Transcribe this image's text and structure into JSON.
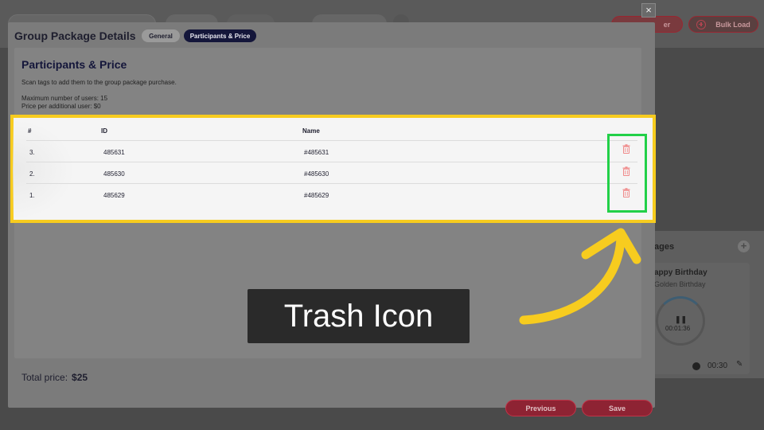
{
  "background": {
    "topbar_right_buttons": [
      "er",
      "Bulk Load"
    ],
    "panel": {
      "title": "ages",
      "add_icon": "plus-icon",
      "card": {
        "name": "appy Birthday",
        "subtitle": "Golden Birthday",
        "pause_icon": "pause-icon",
        "timer": "00:01:36",
        "duration": "00:30",
        "clock_icon": "clock-icon",
        "edit_icon": "pencil-icon"
      }
    },
    "close_label": "×"
  },
  "modal": {
    "title": "Group Package Details",
    "tabs": [
      {
        "label": "General",
        "active": false
      },
      {
        "label": "Participants & Price",
        "active": true
      }
    ],
    "section": {
      "title": "Participants & Price",
      "description": "Scan tags to add them to the group package purchase.",
      "max_users": "Maximum number of users: 15",
      "price_per_user": "Price per additional user: $0"
    },
    "table": {
      "columns": [
        "#",
        "ID",
        "Name"
      ],
      "rows": [
        {
          "num": "3.",
          "id": "485631",
          "name": "#485631"
        },
        {
          "num": "2.",
          "id": "485630",
          "name": "#485630"
        },
        {
          "num": "1.",
          "id": "485629",
          "name": "#485629"
        }
      ],
      "delete_icon": "trash-icon"
    },
    "total_label": "Total price:",
    "total_value": "$25",
    "buttons": {
      "previous": "Previous",
      "save": "Save"
    }
  },
  "annotation": {
    "callout_text": "Trash Icon",
    "colors": {
      "highlight": "#f7cc1f",
      "icon_box": "#22d048",
      "arrow": "#f7cc1f"
    }
  }
}
